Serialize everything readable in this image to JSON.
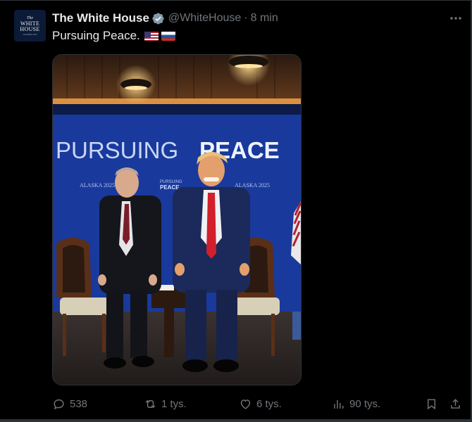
{
  "tweet": {
    "author_name": "The White House",
    "handle": "@WhiteHouse",
    "separator": "·",
    "time": "8 min",
    "text": "Pursuing Peace.",
    "flags": [
      "flag-us-icon",
      "flag-ru-icon"
    ]
  },
  "avatar": {
    "line1": "The",
    "line2": "WHITE",
    "line3": "HOUSE",
    "line4": "WASHINGTON"
  },
  "media": {
    "banner_text_light": "PURSUING",
    "banner_text_bold": "PEACE",
    "small_logo_line1": "PURSUING",
    "small_logo_line2": "PEACE",
    "event_label_left": "ALASKA 2025",
    "event_label_right": "ALASKA 2025"
  },
  "actions": {
    "replies": "538",
    "reposts": "1 tys.",
    "likes": "6 tys.",
    "views": "90 tys."
  },
  "colors": {
    "background": "#000000",
    "text_primary": "#e7e9ea",
    "text_secondary": "#71767b",
    "verified_badge": "#829aab",
    "backdrop_blue": "#1d3fa8"
  }
}
